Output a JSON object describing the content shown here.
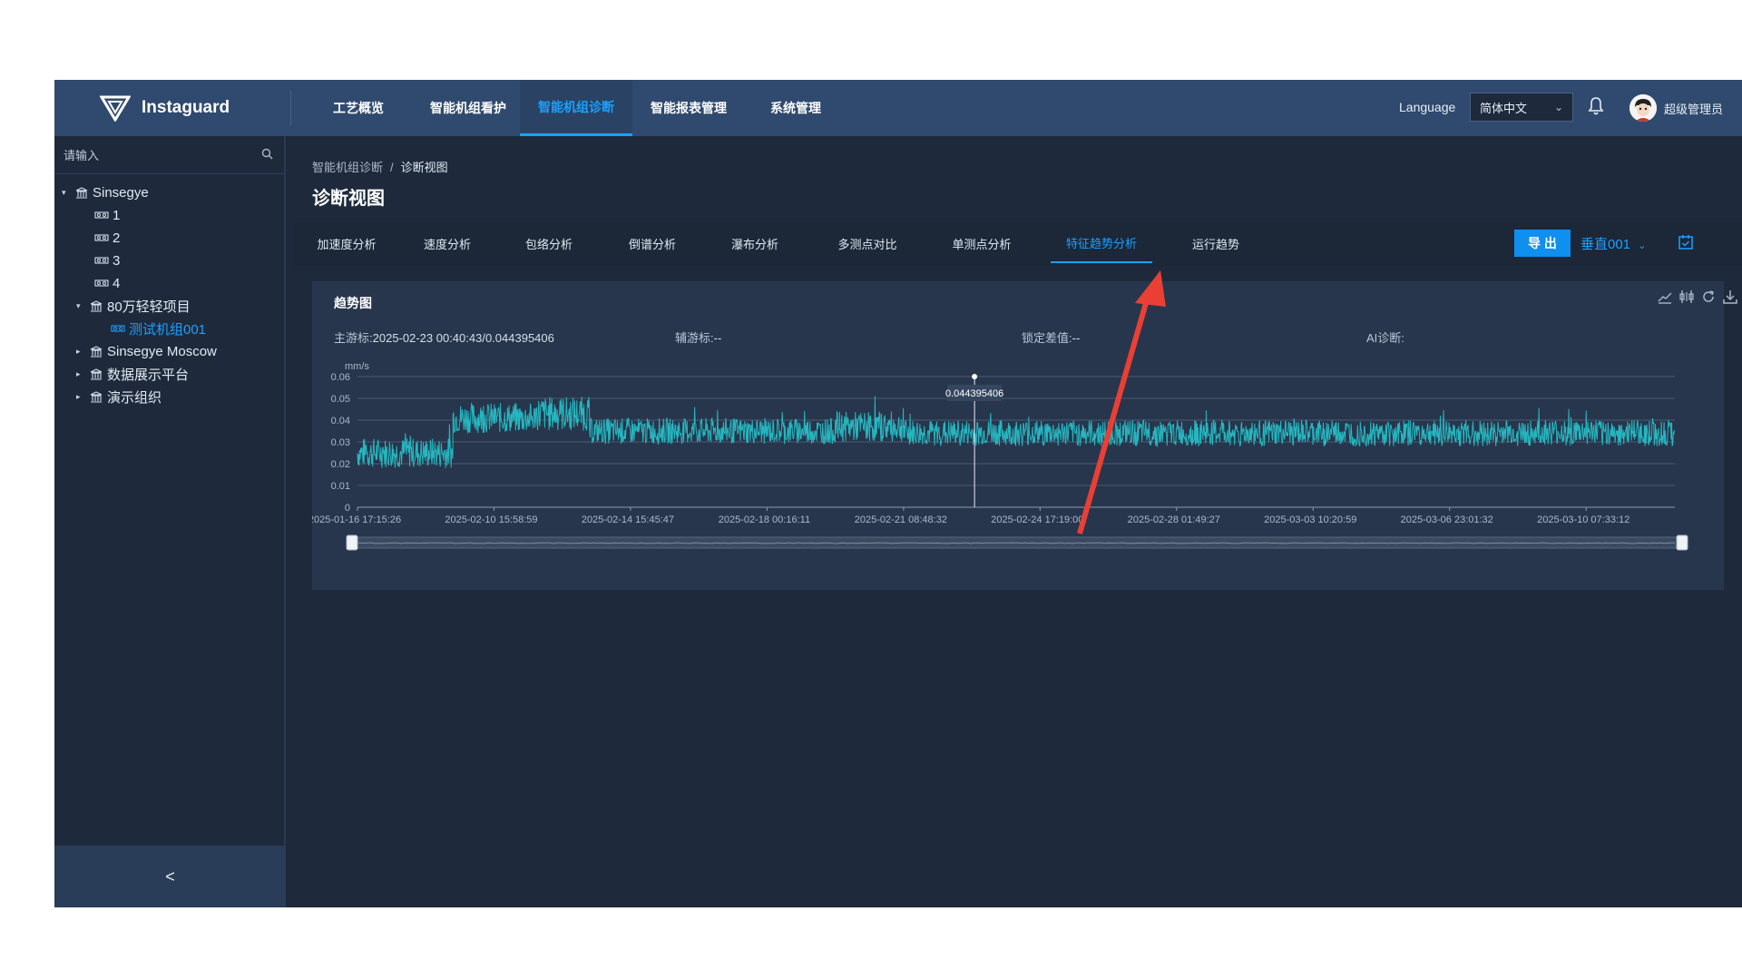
{
  "app": {
    "brand": "Instaguard",
    "nav": [
      {
        "label": "工艺概览",
        "active": false
      },
      {
        "label": "智能机组看护",
        "active": false
      },
      {
        "label": "智能机组诊断",
        "active": true
      },
      {
        "label": "智能报表管理",
        "active": false
      },
      {
        "label": "系统管理",
        "active": false
      }
    ],
    "language_label": "Language",
    "language_value": "简体中文",
    "user_name": "超级管理员"
  },
  "sidebar": {
    "search_placeholder": "请输入",
    "tree": [
      {
        "label": "Sinsegye",
        "type": "org",
        "expanded": true
      },
      {
        "label": "1",
        "type": "device"
      },
      {
        "label": "2",
        "type": "device"
      },
      {
        "label": "3",
        "type": "device"
      },
      {
        "label": "4",
        "type": "device"
      },
      {
        "label": "80万轻轻项目",
        "type": "org",
        "expanded": true
      },
      {
        "label": "测试机组001",
        "type": "device",
        "selected": true
      },
      {
        "label": "Sinsegye Moscow",
        "type": "org",
        "expanded": false
      },
      {
        "label": "数据展示平台",
        "type": "org",
        "expanded": false
      },
      {
        "label": "演示组织",
        "type": "org",
        "expanded": false
      }
    ],
    "collapse_glyph": "<"
  },
  "main": {
    "breadcrumb": {
      "parent": "智能机组诊断",
      "separator": "/",
      "current": "诊断视图"
    },
    "title": "诊断视图",
    "tabs": [
      {
        "label": "加速度分析",
        "active": false
      },
      {
        "label": "速度分析",
        "active": false
      },
      {
        "label": "包络分析",
        "active": false
      },
      {
        "label": "倒谱分析",
        "active": false
      },
      {
        "label": "瀑布分析",
        "active": false
      },
      {
        "label": "多测点对比",
        "active": false
      },
      {
        "label": "单测点分析",
        "active": false
      },
      {
        "label": "特征趋势分析",
        "active": true
      },
      {
        "label": "运行趋势",
        "active": false
      }
    ],
    "export_label": "导 出",
    "channel": "垂直001",
    "accent_color": "#1aa0ff"
  },
  "trend": {
    "card_title": "趋势图",
    "main_cursor_label": "主游标:",
    "main_cursor_value": "2025-02-23 00:40:43/0.044395406",
    "aux_cursor_label": "辅游标:",
    "aux_cursor_value": "--",
    "lock_diff_label": "锁定差值:",
    "lock_diff_value": "--",
    "ai_label": "AI诊断:",
    "ai_value": "",
    "tooltip_value": "0.044395406",
    "unit": "mm/s",
    "series_color": "#26b6bf"
  },
  "chart_data": {
    "type": "line",
    "title": "趋势图",
    "ylabel": "mm/s",
    "ylim": [
      0,
      0.06
    ],
    "yticks": [
      "0",
      "0.01",
      "0.02",
      "0.03",
      "0.04",
      "0.05",
      "0.06"
    ],
    "xticks": [
      "2025-01-16 17:15:26",
      "2025-02-10 15:58:59",
      "2025-02-14 15:45:47",
      "2025-02-18 00:16:11",
      "2025-02-21 08:48:32",
      "2025-02-24 17:19:00",
      "2025-02-28 01:49:27",
      "2025-03-03 10:20:59",
      "2025-03-06 23:01:32",
      "2025-03-10 07:33:12"
    ],
    "grid": true,
    "series": [
      {
        "segments": [
          {
            "from_tick": 0.0,
            "to_tick": 0.7,
            "mean": 0.025,
            "spread": 0.007
          },
          {
            "from_tick": 0.7,
            "to_tick": 1.3,
            "mean": 0.041,
            "spread": 0.007
          },
          {
            "from_tick": 1.3,
            "to_tick": 1.7,
            "mean": 0.043,
            "spread": 0.008
          },
          {
            "from_tick": 1.7,
            "to_tick": 3.5,
            "mean": 0.035,
            "spread": 0.006
          },
          {
            "from_tick": 3.5,
            "to_tick": 4.0,
            "mean": 0.037,
            "spread": 0.007
          },
          {
            "from_tick": 4.0,
            "to_tick": 9.65,
            "mean": 0.034,
            "spread": 0.006
          }
        ]
      }
    ],
    "marker": {
      "x": "2025-02-23 00:40:43",
      "y": 0.044395406
    }
  }
}
